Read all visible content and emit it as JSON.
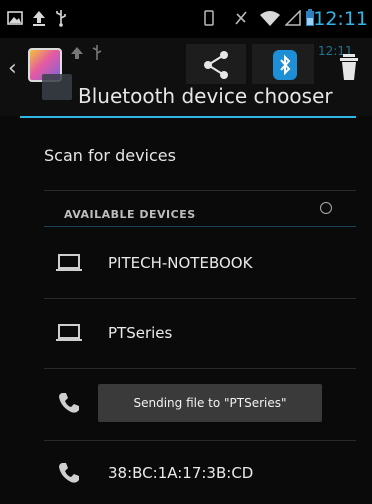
{
  "status_bar": {
    "time": "12:11",
    "left_icons": [
      "image-icon",
      "upload-icon",
      "usb-icon"
    ],
    "right_icons": [
      "vibrate-icon",
      "no-signal-icon",
      "wifi-icon",
      "signal-icon",
      "battery-icon"
    ]
  },
  "header": {
    "title": "Bluetooth device chooser",
    "ghost_time": "12:11"
  },
  "content": {
    "scan_label": "Scan for devices",
    "section_header": "AVAILABLE DEVICES",
    "devices": [
      {
        "name": "PITECH-NOTEBOOK",
        "icon": "laptop-icon"
      },
      {
        "name": "PTSeries",
        "icon": "laptop-icon"
      },
      {
        "name": "",
        "icon": "phone-icon"
      },
      {
        "name": "38:BC:1A:17:3B:CD",
        "icon": "phone-icon"
      }
    ],
    "toast": "Sending file to \"PTSeries\""
  },
  "colors": {
    "accent": "#33b5e5",
    "background": "#0a0a0a",
    "toast": "#3a3a3a",
    "bluetooth_badge": "#1e8fd6"
  }
}
